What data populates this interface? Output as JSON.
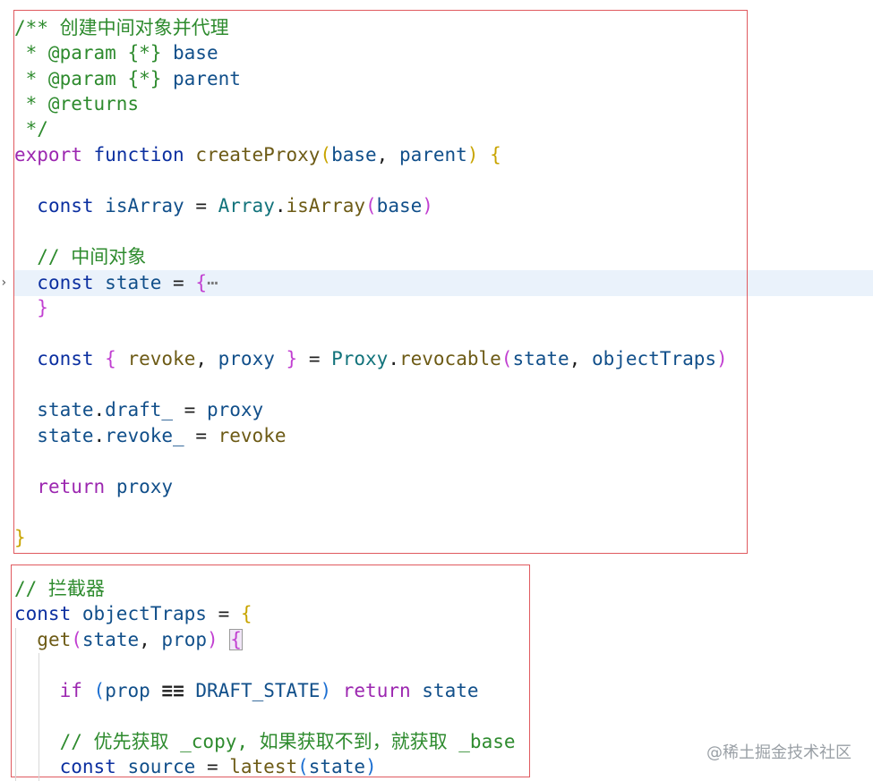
{
  "editor": {
    "lines_block1": [
      "/** 创建中间对象并代理",
      " * @param {*} base",
      " * @param {*} parent",
      " * @returns",
      " */",
      "export function createProxy(base, parent) {",
      "",
      "  const isArray = Array.isArray(base)",
      "",
      "  // 中间对象",
      "  const state = {⋯",
      "  }",
      "",
      "  const { revoke, proxy } = Proxy.revocable(state, objectTraps)",
      "",
      "  state.draft_ = proxy",
      "  state.revoke_ = revoke",
      "",
      "  return proxy",
      "",
      "}"
    ],
    "lines_block2": [
      "// 拦截器",
      "const objectTraps = {",
      "  get(state, prop) {",
      "",
      "    if (prop === DRAFT_STATE) return state",
      "",
      "    // 优先获取 _copy, 如果获取不到，就获取 _base",
      "    const source = latest(state)"
    ],
    "fold_icon": "chevron-right-icon"
  },
  "watermark": {
    "text": "@稀土掘金技术社区"
  },
  "colors": {
    "highlight_line": "#eaf2fb",
    "annotation_box": "#e05a5f"
  }
}
